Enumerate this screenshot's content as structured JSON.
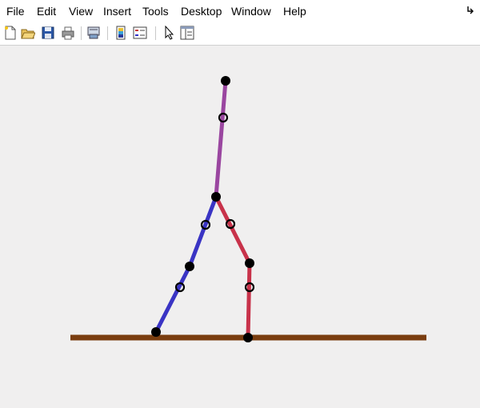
{
  "menubar": {
    "items": [
      "File",
      "Edit",
      "View",
      "Insert",
      "Tools",
      "Desktop",
      "Window",
      "Help"
    ]
  },
  "toolbar": {
    "buttons": [
      "new-figure-icon",
      "open-file-icon",
      "save-icon",
      "print-icon",
      "print-preview-icon",
      "colorbar-icon",
      "legend-icon",
      "pointer-icon",
      "property-editor-icon"
    ]
  },
  "figure": {
    "background": "#f0efef",
    "ground_color": "#7a3d0f",
    "torso_color": "#9a46a0",
    "left_leg_color": "#3a34c4",
    "right_leg_color": "#c8324a",
    "joint_color": "#000000"
  }
}
